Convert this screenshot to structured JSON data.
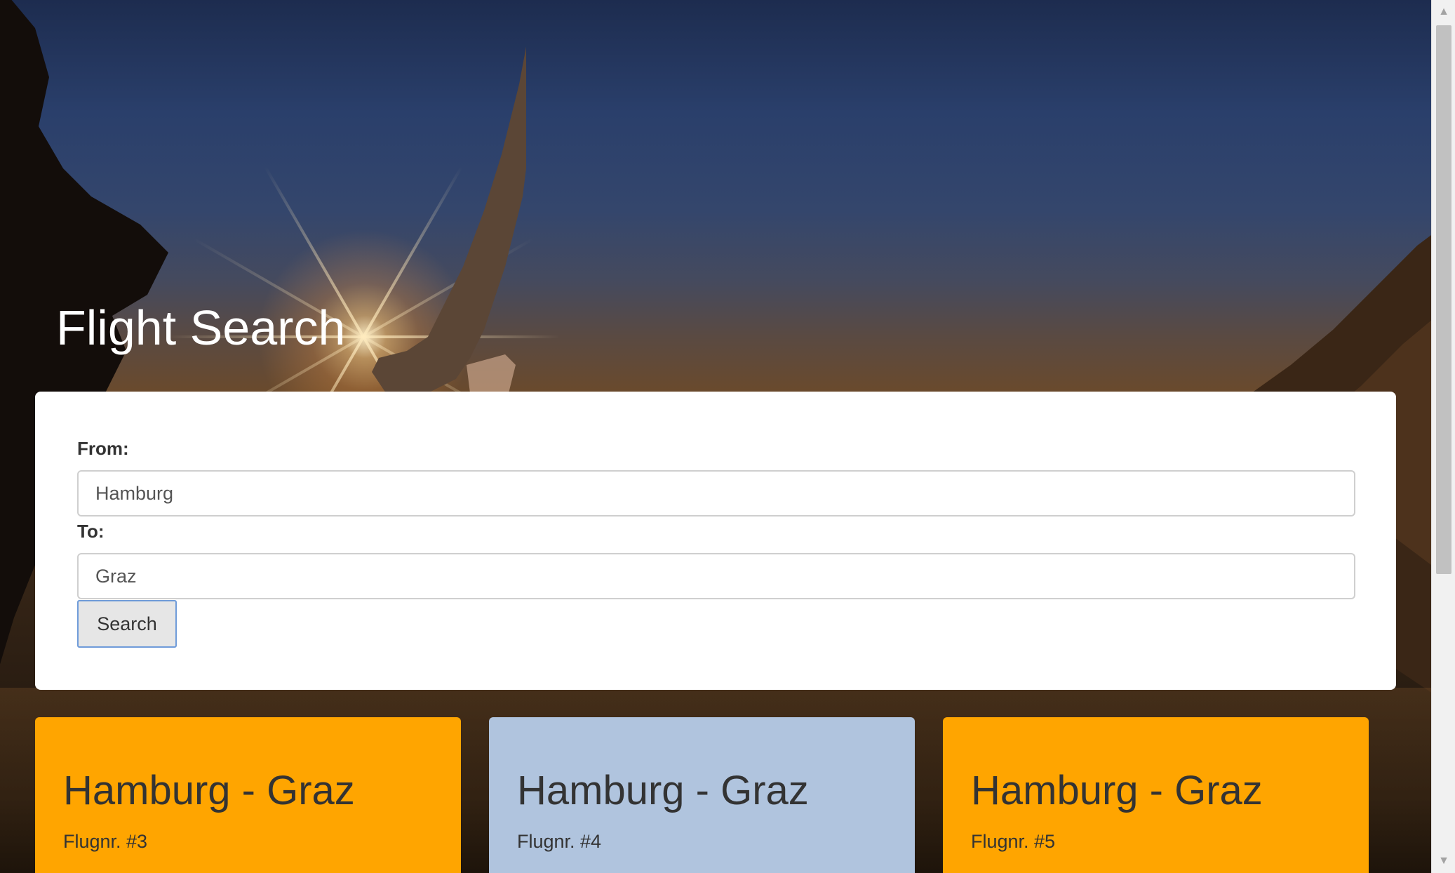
{
  "header": {
    "title": "Flight Search"
  },
  "search": {
    "from_label": "From:",
    "from_value": "Hamburg",
    "to_label": "To:",
    "to_value": "Graz",
    "button_label": "Search"
  },
  "results": [
    {
      "route": "Hamburg - Graz",
      "flight_number": "Flugnr. #3",
      "color": "#ffa500"
    },
    {
      "route": "Hamburg - Graz",
      "flight_number": "Flugnr. #4",
      "color": "#b0c4de"
    },
    {
      "route": "Hamburg - Graz",
      "flight_number": "Flugnr. #5",
      "color": "#ffa500"
    }
  ],
  "scrollbar": {
    "up_icon": "triangle-up-icon",
    "down_icon": "triangle-down-icon"
  }
}
